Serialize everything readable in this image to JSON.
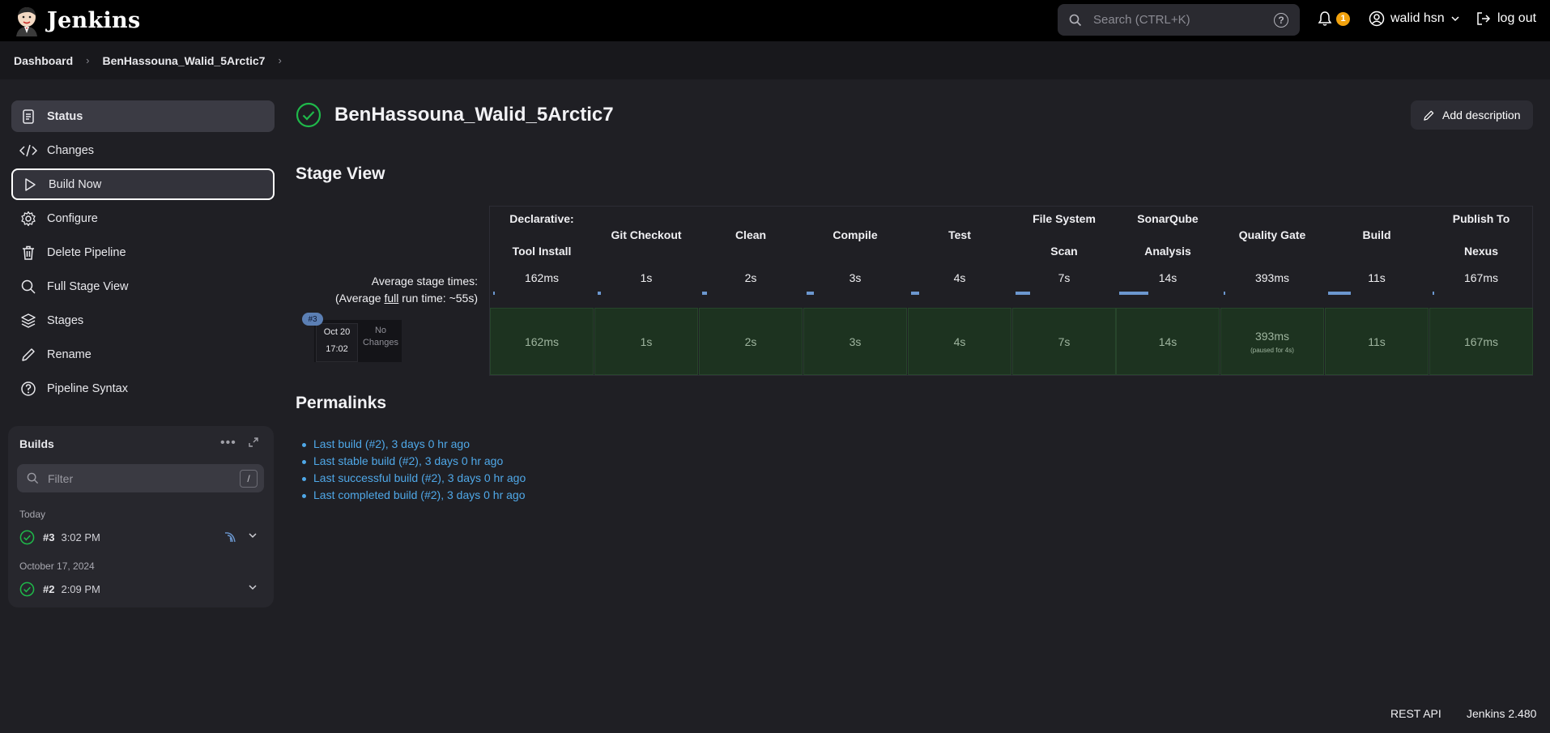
{
  "header": {
    "app_name": "Jenkins",
    "search_placeholder": "Search (CTRL+K)",
    "help_glyph": "?",
    "notification_count": "1",
    "user_name": "walid hsn",
    "logout_label": "log out"
  },
  "breadcrumb": {
    "items": [
      "Dashboard",
      "BenHassouna_Walid_5Arctic7"
    ]
  },
  "sidebar": {
    "items": [
      {
        "label": "Status",
        "icon": "document-icon"
      },
      {
        "label": "Changes",
        "icon": "code-icon"
      },
      {
        "label": "Build Now",
        "icon": "play-icon"
      },
      {
        "label": "Configure",
        "icon": "gear-icon"
      },
      {
        "label": "Delete Pipeline",
        "icon": "trash-icon"
      },
      {
        "label": "Full Stage View",
        "icon": "search-icon"
      },
      {
        "label": "Stages",
        "icon": "layers-icon"
      },
      {
        "label": "Rename",
        "icon": "pencil-icon"
      },
      {
        "label": "Pipeline Syntax",
        "icon": "question-icon"
      }
    ]
  },
  "builds": {
    "title": "Builds",
    "more": "•••",
    "filter_placeholder": "Filter",
    "filter_shortcut": "/",
    "groups": [
      {
        "label": "Today",
        "build": {
          "number": "#3",
          "time": "3:02 PM"
        }
      },
      {
        "label": "October 17, 2024",
        "build": {
          "number": "#2",
          "time": "2:09 PM"
        }
      }
    ]
  },
  "main": {
    "title": "BenHassouna_Walid_5Arctic7",
    "add_description": "Add description",
    "stage_view_title": "Stage View",
    "avg_label_line1": "Average stage times:",
    "avg_label_line2_pre": "(Average ",
    "avg_label_line2_u": "full",
    "avg_label_line2_post": " run time: ~55s)",
    "run": {
      "badge": "#3",
      "date": "Oct 20",
      "time": "17:02",
      "changes_line1": "No",
      "changes_line2": "Changes"
    },
    "stages": [
      {
        "name_l1": "Declarative:",
        "name_l2": "Tool Install",
        "avg": "162ms",
        "cell": "162ms",
        "bar": 0.0
      },
      {
        "name_l1": "Git Checkout",
        "name_l2": "",
        "avg": "1s",
        "cell": "1s",
        "bar": 0.03
      },
      {
        "name_l1": "Clean",
        "name_l2": "",
        "avg": "2s",
        "cell": "2s",
        "bar": 0.05
      },
      {
        "name_l1": "Compile",
        "name_l2": "",
        "avg": "3s",
        "cell": "3s",
        "bar": 0.07
      },
      {
        "name_l1": "Test",
        "name_l2": "",
        "avg": "4s",
        "cell": "4s",
        "bar": 0.08
      },
      {
        "name_l1": "File System",
        "name_l2": "Scan",
        "avg": "7s",
        "cell": "7s",
        "bar": 0.14
      },
      {
        "name_l1": "SonarQube",
        "name_l2": "Analysis",
        "avg": "14s",
        "cell": "14s",
        "bar": 0.28
      },
      {
        "name_l1": "Quality Gate",
        "name_l2": "",
        "avg": "393ms",
        "cell": "393ms",
        "cell_sub": "(paused for 4s)",
        "bar": 0.0
      },
      {
        "name_l1": "Build",
        "name_l2": "",
        "avg": "11s",
        "cell": "11s",
        "bar": 0.22
      },
      {
        "name_l1": "Publish To",
        "name_l2": "Nexus",
        "avg": "167ms",
        "cell": "167ms",
        "bar": 0.0
      }
    ],
    "permalinks_title": "Permalinks",
    "permalinks": [
      "Last build (#2), 3 days 0 hr ago",
      "Last stable build (#2), 3 days 0 hr ago",
      "Last successful build (#2), 3 days 0 hr ago",
      "Last completed build (#2), 3 days 0 hr ago"
    ]
  },
  "footer": {
    "rest_api": "REST API",
    "version": "Jenkins 2.480"
  },
  "colors": {
    "success": "#1fb84a",
    "link": "#4fa8e8",
    "stage_success_bg": "#1d3320",
    "notification": "#f2a20d",
    "run_badge": "#5b7fb4"
  }
}
